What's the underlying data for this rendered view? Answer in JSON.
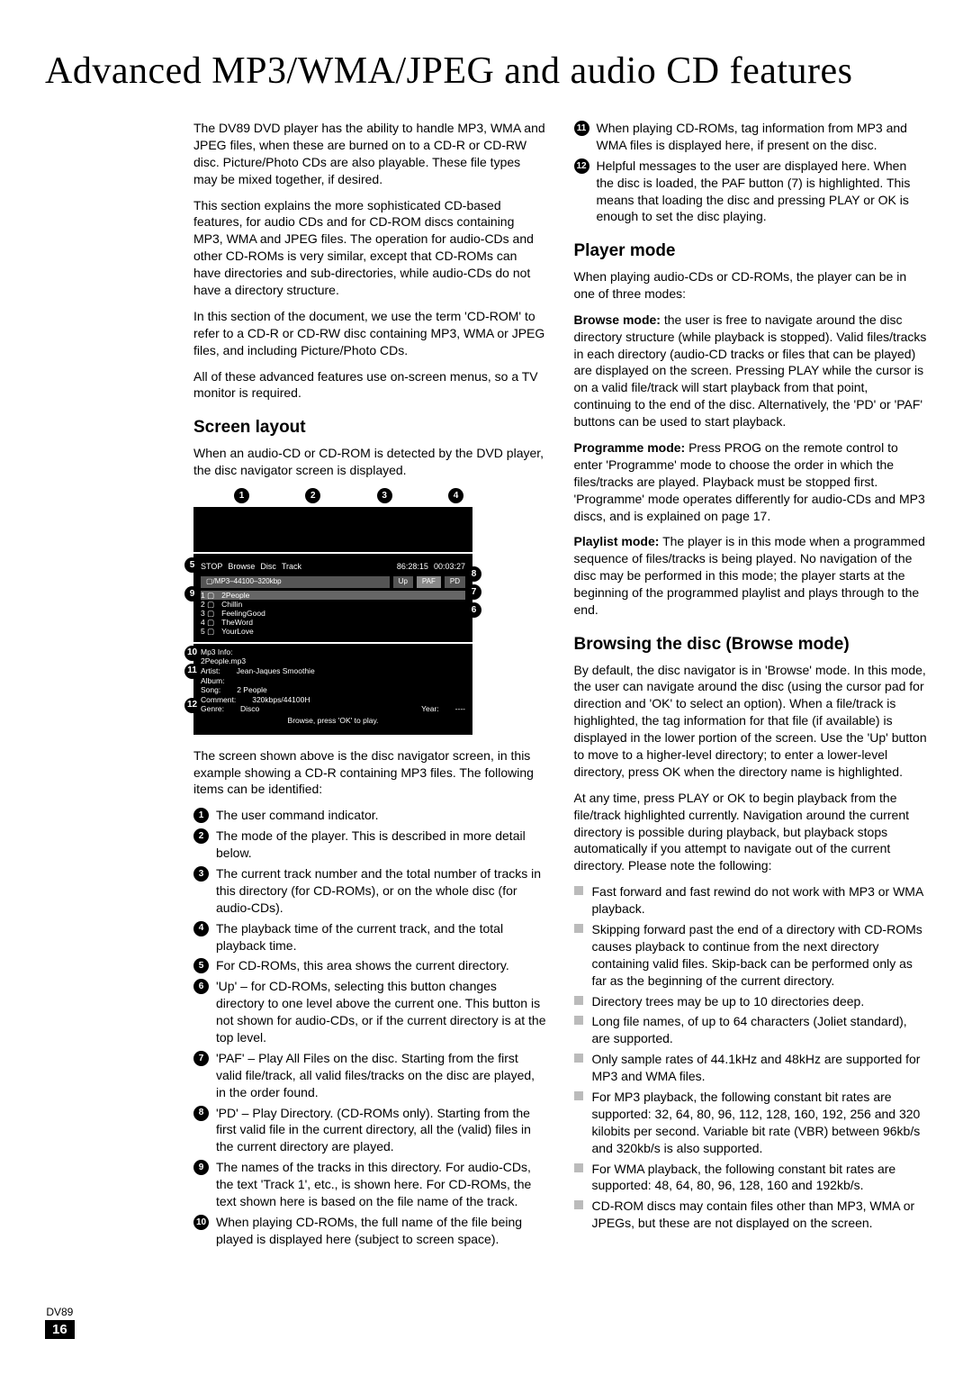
{
  "title": "Advanced MP3/WMA/JPEG and audio CD features",
  "intro": {
    "p1": "The DV89 DVD player has the ability to handle MP3, WMA and JPEG files, when these are burned on to a CD-R or CD-RW disc. Picture/Photo CDs are also playable. These file types may be mixed together, if desired.",
    "p2": "This section explains the more sophisticated CD-based features, for audio CDs and for CD-ROM discs containing MP3, WMA and JPEG files. The operation for audio-CDs and other CD-ROMs is very similar, except that CD-ROMs can have directories and sub-directories, while audio-CDs do not have a directory structure.",
    "p3": "In this section of the document, we use the term 'CD-ROM' to refer to a CD-R or CD-RW disc containing MP3, WMA or JPEG files, and including Picture/Photo CDs.",
    "p4": "All of these advanced features use on-screen menus, so a TV monitor is required."
  },
  "screen_layout": {
    "heading": "Screen layout",
    "lead": "When an audio-CD or CD-ROM is detected by the DVD player, the disc navigator screen is displayed.",
    "top_callouts": [
      "1",
      "2",
      "3",
      "4"
    ],
    "left_callouts": [
      "5",
      "9",
      "10",
      "11",
      "12"
    ],
    "right_callouts": [
      "8",
      "7",
      "6"
    ],
    "screen": {
      "status": [
        "STOP",
        "Browse",
        "Disc",
        "Track",
        "86:28:15",
        "00:03:27"
      ],
      "path": "▢/MP3–44100–320kbp",
      "tabs": [
        "Up",
        "PAF",
        "PD"
      ],
      "tracks": [
        {
          "n": "1 ▢",
          "name": "2People"
        },
        {
          "n": "2 ▢",
          "name": "Chillin"
        },
        {
          "n": "3 ▢",
          "name": "FeelingGood"
        },
        {
          "n": "4 ▢",
          "name": "TheWord"
        },
        {
          "n": "5 ▢",
          "name": "YourLove"
        }
      ],
      "info": {
        "title": "Mp3 Info:",
        "file": "2People.mp3",
        "artist_label": "Artist:",
        "artist": "Jean-Jaques Smoothie",
        "album_label": "Album:",
        "song_label": "Song:",
        "song": "2 People",
        "comment_label": "Comment:",
        "comment": "320kbps/44100H",
        "genre_label": "Genre:",
        "genre": "Disco",
        "year_label": "Year:",
        "year": "----",
        "footer": "Browse, press 'OK' to play."
      }
    },
    "caption": "The screen shown above is the disc navigator screen, in this example showing a CD-R containing MP3 files. The following items can be identified:",
    "items": [
      "The user command indicator.",
      "The mode of the player. This is described in more detail below.",
      "The current track number and the total number of tracks in this directory (for CD-ROMs), or on the whole disc (for audio-CDs).",
      "The playback time of the current track, and the total playback time.",
      "For CD-ROMs, this area shows the current directory.",
      "'Up' – for CD-ROMs, selecting this button changes directory to one level above the current one. This button is not shown for audio-CDs, or if the current directory is at the top level.",
      "'PAF' – Play All Files on the disc. Starting from the first valid file/track, all valid files/tracks on the disc are played, in the order found.",
      "'PD' – Play Directory. (CD-ROMs only). Starting from the first valid file in the current directory, all the (valid) files in the current directory are played.",
      "The names of the tracks in this directory. For audio-CDs, the text 'Track 1', etc., is shown here. For CD-ROMs, the text shown here is based on the file name of the track.",
      "When playing CD-ROMs, the full name of the file being played is displayed here (subject to screen space).",
      "When playing CD-ROMs, tag information from MP3 and WMA files is displayed here, if present on the disc.",
      "Helpful messages to the user are displayed here. When the disc is loaded, the PAF button (7) is highlighted. This means that loading the disc and pressing PLAY or OK is enough to set the disc playing."
    ]
  },
  "player_mode": {
    "heading": "Player mode",
    "lead": "When playing audio-CDs or CD-ROMs, the player can be in one of three modes:",
    "browse_label": "Browse mode:",
    "browse": "the user is free to navigate around the disc directory structure (while playback is stopped). Valid files/tracks in each directory (audio-CD tracks or files that can be played) are displayed on the screen. Pressing PLAY while the cursor is on a valid file/track will start playback from that point, continuing to the end of the disc. Alternatively, the 'PD' or 'PAF' buttons can be used to start playback.",
    "prog_label": "Programme mode:",
    "prog": "Press PROG on the remote control to enter 'Programme' mode to choose the order in which the files/tracks are played. Playback must be stopped first. 'Programme' mode operates differently for audio-CDs and MP3 discs, and is explained on page 17.",
    "playlist_label": "Playlist mode:",
    "playlist": "The player is in this mode when a programmed sequence of files/tracks is being played. No navigation of the disc may be performed in this mode; the player starts at the beginning of the programmed playlist and plays through to the end."
  },
  "browsing": {
    "heading": "Browsing the disc (Browse mode)",
    "p1": "By default, the disc navigator is in 'Browse' mode. In this mode, the user can navigate around the disc (using the cursor pad for direction and 'OK' to select an option). When a file/track is highlighted, the tag information for that file (if available) is displayed in the lower portion of the screen. Use the 'Up' button to move to a higher-level directory; to enter a lower-level directory, press OK when the directory name is highlighted.",
    "p2": "At any time, press PLAY or OK to begin playback from the file/track highlighted currently. Navigation around the current directory is possible during playback, but playback stops automatically if you attempt to navigate out of the current directory. Please note the following:",
    "bullets": [
      "Fast forward and fast rewind do not work with MP3 or WMA playback.",
      "Skipping forward past the end of a directory with CD-ROMs causes playback to continue from the next directory containing valid files. Skip-back can be performed only as far as the beginning of the current directory.",
      "Directory trees may be up to 10 directories deep.",
      "Long file names, of up to 64 characters (Joliet standard), are supported.",
      "Only sample rates of 44.1kHz and 48kHz are supported for MP3 and WMA files.",
      "For MP3 playback, the following constant bit rates are supported: 32, 64, 80, 96, 112, 128, 160, 192, 256 and 320 kilobits per second. Variable bit rate (VBR) between 96kb/s and 320kb/s is also supported.",
      "For WMA playback, the following constant bit rates are supported: 48, 64, 80, 96, 128, 160 and 192kb/s.",
      "CD-ROM discs may contain files other than MP3, WMA or JPEGs, but these are not displayed on the screen."
    ]
  },
  "footer": {
    "model": "DV89",
    "page": "16"
  }
}
